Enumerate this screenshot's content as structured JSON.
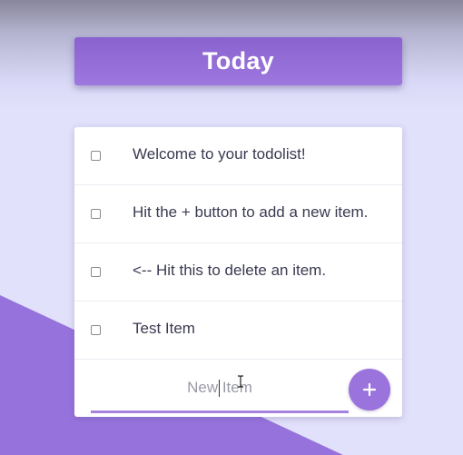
{
  "header": {
    "title": "Today"
  },
  "todos": [
    {
      "text": "Welcome to your todolist!",
      "checked": false
    },
    {
      "text": "Hit the + button to add a new item.",
      "checked": false
    },
    {
      "text": "<-- Hit this to delete an item.",
      "checked": false
    },
    {
      "text": "Test Item",
      "checked": false
    }
  ],
  "new_item": {
    "placeholder": "New Item",
    "value": ""
  },
  "add_button": {
    "icon": "plus-icon"
  },
  "colors": {
    "accent": "#9b73dc",
    "title_banner": "#9470d8",
    "background": "#e2e1fb",
    "triangle": "#9673dc",
    "item_text": "#3a3a52"
  }
}
